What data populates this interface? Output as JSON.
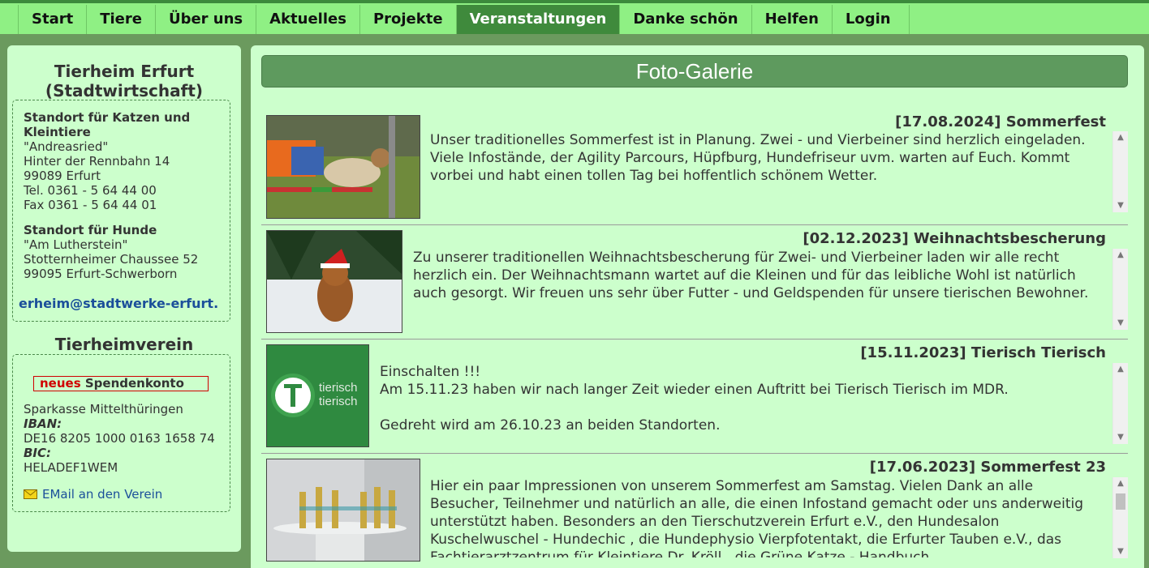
{
  "nav": {
    "items": [
      "Start",
      "Tiere",
      "Über uns",
      "Aktuelles",
      "Projekte",
      "Veranstaltungen",
      "Danke schön",
      "Helfen",
      "Login"
    ],
    "active": "Veranstaltungen"
  },
  "sidebar": {
    "title_line1": "Tierheim Erfurt",
    "title_line2": "(Stadtwirtschaft)",
    "cats": {
      "heading": "Standort für Katzen und Kleintiere",
      "name": "\"Andreasried\"",
      "street": "Hinter der Rennbahn 14",
      "city": "99089 Erfurt",
      "tel": "Tel. 0361 - 5 64 44 00",
      "fax": "Fax 0361 - 5 64 44 01"
    },
    "dogs": {
      "heading": "Standort für Hunde",
      "name": "\"Am Lutherstein\"",
      "street": "Stotternheimer Chaussee 52",
      "city": "99095 Erfurt-Schwerborn"
    },
    "email": "erheim@stadtwerke-erfurt.",
    "verein_title": "Tierheimverein",
    "konto_new": "neues",
    "konto_label": "Spendenkonto",
    "bank": "Sparkasse Mittelthüringen",
    "iban_label": "IBAN:",
    "iban": "DE16 8205 1000 0163 1658 74",
    "bic_label": "BIC:",
    "bic": "HELADEF1WEM",
    "mail_link": "EMail an den Verein"
  },
  "main": {
    "banner": "Foto-Galerie",
    "events": [
      {
        "title": "[17.08.2024] Sommerfest",
        "text": "Unser traditionelles Sommerfest ist in Planung. Zwei - und Vierbeiner sind herzlich eingeladen. Viele Infostände, der Agility Parcours, Hüpfburg, Hundefriseur uvm. warten auf Euch. Kommt vorbei und habt einen tollen Tag bei hoffentlich schönem Wetter."
      },
      {
        "title": "[02.12.2023] Weihnachtsbescherung",
        "text": "Zu unserer traditionellen Weihnachtsbescherung für Zwei- und Vierbeiner laden wir alle recht herzlich ein. Der Weihnachtsmann wartet auf die Kleinen und für das leibliche Wohl ist natürlich auch gesorgt. Wir freuen uns sehr über Futter - und Geldspenden für unsere tierischen Bewohner."
      },
      {
        "title": "[15.11.2023] Tierisch Tierisch",
        "text": "Einschalten !!!\nAm 15.11.23 haben wir nach langer Zeit wieder einen Auftritt bei Tierisch Tierisch im MDR.\n\nGedreht wird am 26.10.23 an beiden Standorten.",
        "logo_text1": "tierisch",
        "logo_text2": "tierisch"
      },
      {
        "title": "[17.06.2023] Sommerfest 23",
        "text": "Hier ein paar Impressionen von unserem Sommerfest am Samstag. Vielen Dank an alle Besucher, Teilnehmer und natürlich an alle, die einen Infostand gemacht oder uns anderweitig unterstützt haben. Besonders an den Tierschutzverein Erfurt e.V., den Hundesalon Kuschelwuschel - Hundechic , die Hundephysio Vierpfotentakt, die Erfurter Tauben e.V., das Fachtierarztzentrum für Kleintiere Dr. Kröll , die Grüne Katze - Handbuch"
      }
    ]
  },
  "colors": {
    "nav_bg": "#8ff084",
    "nav_active": "#3f8a3c",
    "panel_bg": "#ccffcc",
    "page_bg": "#6b9a5e",
    "banner_bg": "#5e9a5e",
    "link": "#1b4f9a",
    "accent_red": "#d00000"
  }
}
